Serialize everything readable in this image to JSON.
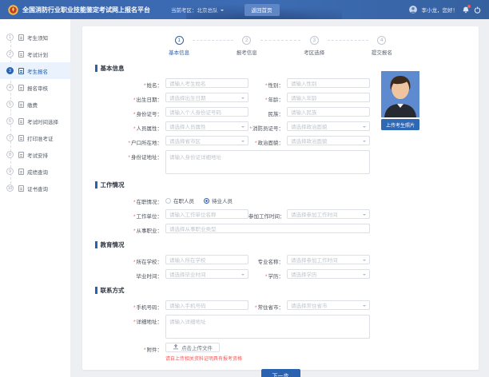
{
  "meta": {
    "required_mark": "*"
  },
  "colors": {
    "accent": "#2b62b0",
    "danger": "#f25a5a",
    "header_bg": "#3d6cb4",
    "header_btn": "#5f87c6",
    "active_bg": "#e9f2fd"
  },
  "header": {
    "title": "全国消防行业职业技能鉴定考试网上报名平台",
    "region_label": "当前考区：北京总队",
    "home_button": "返回首页",
    "greeting": "李小龙，您好！"
  },
  "sidebar": {
    "items": [
      {
        "num": "1",
        "label": "考生须知",
        "active": false
      },
      {
        "num": "2",
        "label": "考试计划",
        "active": false
      },
      {
        "num": "3",
        "label": "考生报名",
        "active": true
      },
      {
        "num": "4",
        "label": "报名审核",
        "active": false
      },
      {
        "num": "5",
        "label": "缴费",
        "active": false
      },
      {
        "num": "6",
        "label": "考试时间选择",
        "active": false
      },
      {
        "num": "7",
        "label": "打印准考证",
        "active": false
      },
      {
        "num": "8",
        "label": "考试安排",
        "active": false
      },
      {
        "num": "9",
        "label": "成绩查询",
        "active": false
      },
      {
        "num": "10",
        "label": "证书查询",
        "active": false
      }
    ]
  },
  "stepper": {
    "steps": [
      {
        "num": "1",
        "label": "基本信息",
        "active": true
      },
      {
        "num": "2",
        "label": "报考信息",
        "active": false
      },
      {
        "num": "3",
        "label": "考区选择",
        "active": false
      },
      {
        "num": "4",
        "label": "提交报名",
        "active": false
      }
    ]
  },
  "photo": {
    "upload_label": "上传考生照片"
  },
  "form": {
    "sections": [
      {
        "title": "基本信息",
        "rows": [
          {
            "fields": [
              {
                "label": "姓名：",
                "required": true,
                "placeholder": "请输入考生姓名",
                "type": "input"
              },
              {
                "label": "性别：",
                "required": true,
                "placeholder": "请输入性别",
                "type": "input"
              }
            ]
          },
          {
            "fields": [
              {
                "label": "出生日期：",
                "required": true,
                "placeholder": "请选择出生日期",
                "type": "select"
              },
              {
                "label": "年龄：",
                "required": true,
                "placeholder": "请输入年龄",
                "type": "input"
              }
            ]
          },
          {
            "fields": [
              {
                "label": "身份证号：",
                "required": true,
                "placeholder": "请输入个人身份证号码",
                "type": "input"
              },
              {
                "label": "民族：",
                "required": false,
                "placeholder": "请输入民族",
                "type": "input"
              }
            ]
          },
          {
            "fields": [
              {
                "label": "人员属性：",
                "required": true,
                "placeholder": "请选择人员属性",
                "type": "select"
              },
              {
                "label": "消防员证号：",
                "required": true,
                "placeholder": "请选择政治面貌",
                "type": "select"
              }
            ]
          },
          {
            "fields": [
              {
                "label": "户口所在地：",
                "required": true,
                "placeholder": "请选择省市区",
                "type": "select"
              },
              {
                "label": "政治面貌：",
                "required": true,
                "placeholder": "请选择政治面貌",
                "type": "select"
              }
            ]
          },
          {
            "fields": [
              {
                "label": "身份证地址：",
                "required": true,
                "placeholder": "请输入身份证详细地址",
                "type": "textarea",
                "full": true
              }
            ]
          }
        ]
      },
      {
        "title": "工作情况",
        "rows": [
          {
            "fields": [
              {
                "label": "在职情况：",
                "required": true,
                "type": "radio",
                "options": [
                  {
                    "label": "在职人员",
                    "checked": false
                  },
                  {
                    "label": "待业人员",
                    "checked": true
                  }
                ]
              }
            ]
          },
          {
            "fields": [
              {
                "label": "工作单位：",
                "required": true,
                "placeholder": "请输入工作单位名称",
                "type": "input"
              },
              {
                "label": "参加工作时间：",
                "required": false,
                "placeholder": "请选择参加工作时间",
                "type": "select"
              }
            ]
          },
          {
            "fields": [
              {
                "label": "从事职业：",
                "required": true,
                "placeholder": "请选择从事职业类型",
                "type": "input",
                "full": true
              }
            ]
          }
        ]
      },
      {
        "title": "教育情况",
        "rows": [
          {
            "fields": [
              {
                "label": "所在学校：",
                "required": true,
                "placeholder": "请输入所在学校",
                "type": "input"
              },
              {
                "label": "专业名称：",
                "required": false,
                "placeholder": "请选择参加工作时间",
                "type": "select"
              }
            ]
          },
          {
            "fields": [
              {
                "label": "毕业时间：",
                "required": false,
                "placeholder": "请选择毕业时间",
                "type": "select"
              },
              {
                "label": "学历：",
                "required": true,
                "placeholder": "请选择学历",
                "type": "select"
              }
            ]
          }
        ]
      },
      {
        "title": "联系方式",
        "rows": [
          {
            "fields": [
              {
                "label": "手机号码：",
                "required": true,
                "placeholder": "请输入手机号码",
                "type": "input"
              },
              {
                "label": "常住省市：",
                "required": true,
                "placeholder": "请选择常住省市",
                "type": "select"
              }
            ]
          },
          {
            "fields": [
              {
                "label": "详细地址：",
                "required": true,
                "placeholder": "请输入详细地址",
                "type": "textarea",
                "full": true
              }
            ]
          },
          {
            "fields": [
              {
                "label": "附件：",
                "required": true,
                "type": "upload",
                "button_label": "点击上传文件",
                "hint": "请自上传相关资料证明具有报考资格"
              }
            ]
          }
        ]
      }
    ]
  },
  "footer": {
    "next_button": "下一步"
  }
}
